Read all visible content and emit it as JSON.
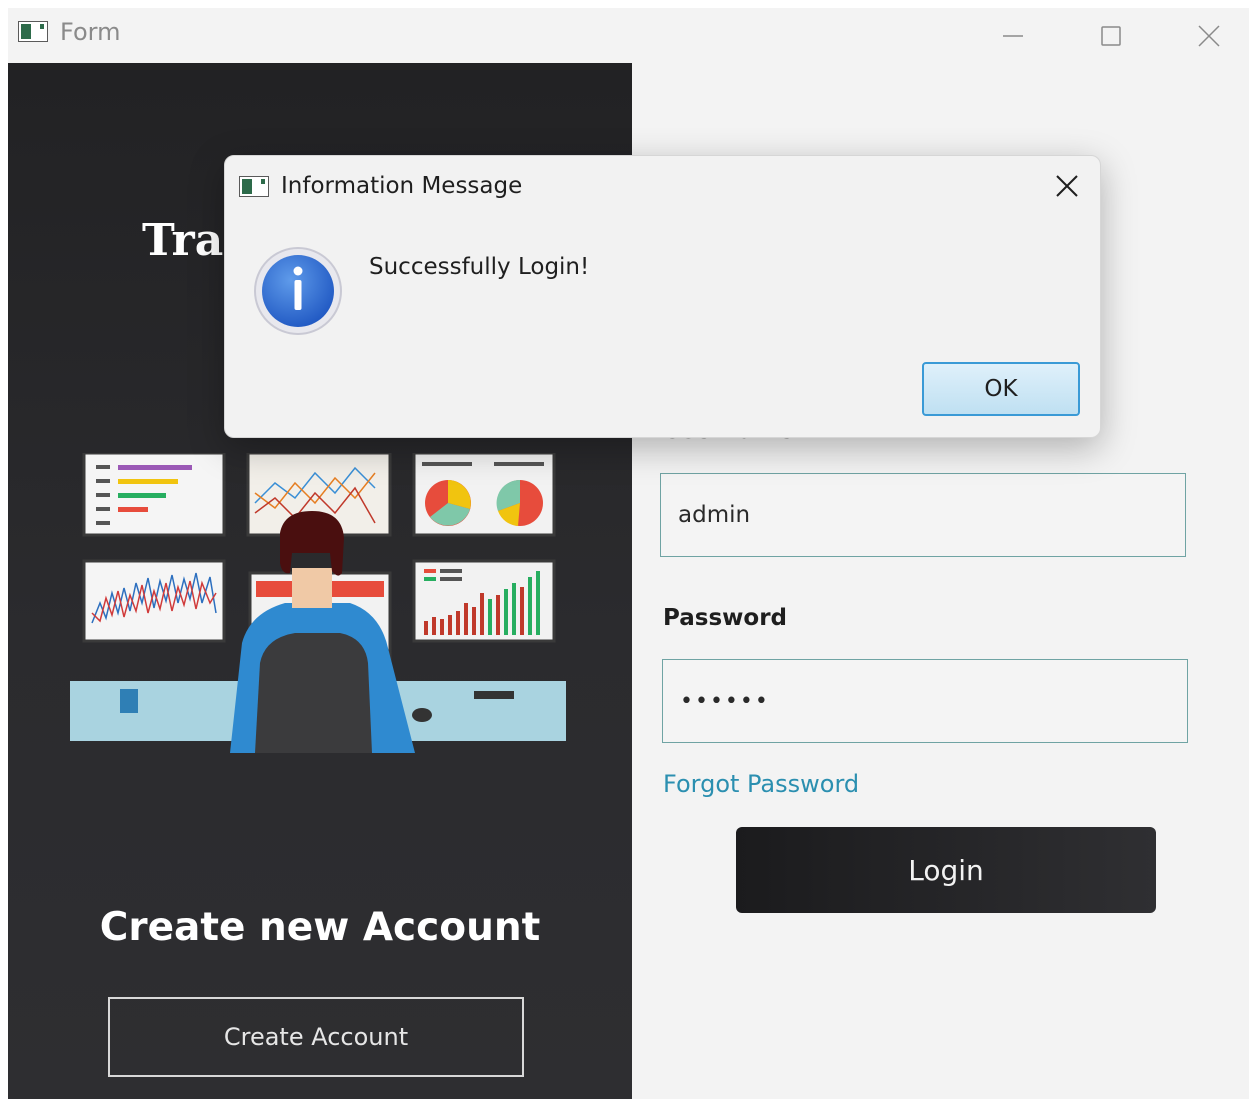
{
  "window": {
    "title": "Form"
  },
  "left": {
    "brand_title": "Tra",
    "create_heading": "Create new Account",
    "create_button": "Create Account"
  },
  "form": {
    "username_label": "Username",
    "username_value": "admin",
    "password_label": "Password",
    "password_value": "••••••",
    "forgot_link": "Forgot Password",
    "login_button": "Login"
  },
  "dialog": {
    "title": "Information Message",
    "message": "Successfully Login!",
    "ok_button": "OK"
  },
  "colors": {
    "left_panel": "#252527",
    "link": "#2b8fb0",
    "field_border": "#6fa3a3",
    "info_blue": "#2f6fd6"
  },
  "icons": [
    "app-window-icon",
    "minimize-icon",
    "maximize-icon",
    "close-icon",
    "info-icon"
  ]
}
